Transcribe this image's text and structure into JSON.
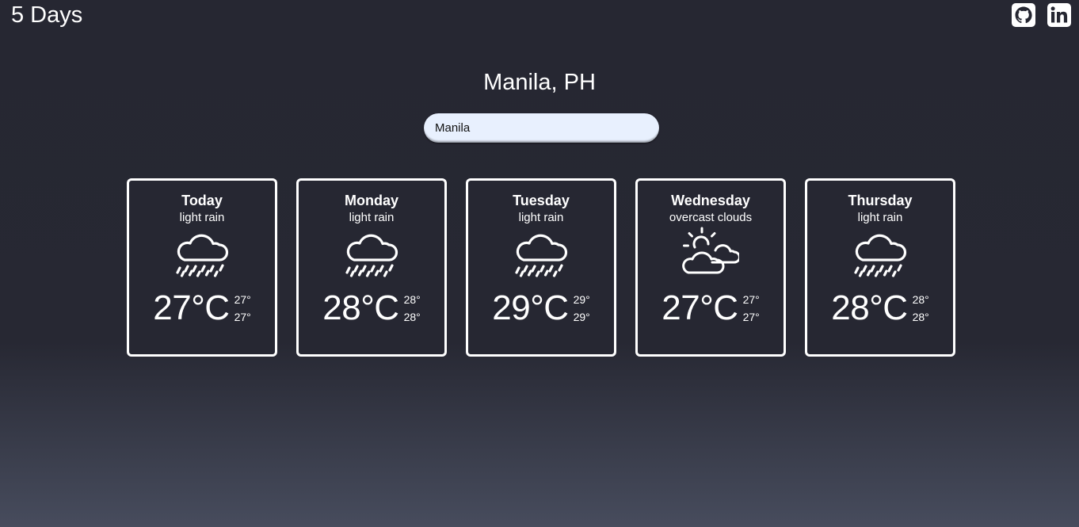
{
  "header": {
    "brand": "5 Days",
    "links": [
      {
        "name": "github-icon"
      },
      {
        "name": "linkedin-icon"
      }
    ]
  },
  "location": {
    "title": "Manila, PH"
  },
  "search": {
    "value": "Manila",
    "placeholder": ""
  },
  "forecast": [
    {
      "day": "Today",
      "desc": "light rain",
      "icon": "rain-cloud-icon",
      "temp": "27°C",
      "high": "27°",
      "low": "27°"
    },
    {
      "day": "Monday",
      "desc": "light rain",
      "icon": "rain-cloud-icon",
      "temp": "28°C",
      "high": "28°",
      "low": "28°"
    },
    {
      "day": "Tuesday",
      "desc": "light rain",
      "icon": "rain-cloud-icon",
      "temp": "29°C",
      "high": "29°",
      "low": "29°"
    },
    {
      "day": "Wednesday",
      "desc": "overcast clouds",
      "icon": "sun-clouds-icon",
      "temp": "27°C",
      "high": "27°",
      "low": "27°"
    },
    {
      "day": "Thursday",
      "desc": "light rain",
      "icon": "rain-cloud-icon",
      "temp": "28°C",
      "high": "28°",
      "low": "28°"
    }
  ],
  "colors": {
    "background_top": "#262732",
    "background_bottom": "#474c5d",
    "card_border": "#ffffff",
    "search_bg": "#e8f0fe"
  }
}
